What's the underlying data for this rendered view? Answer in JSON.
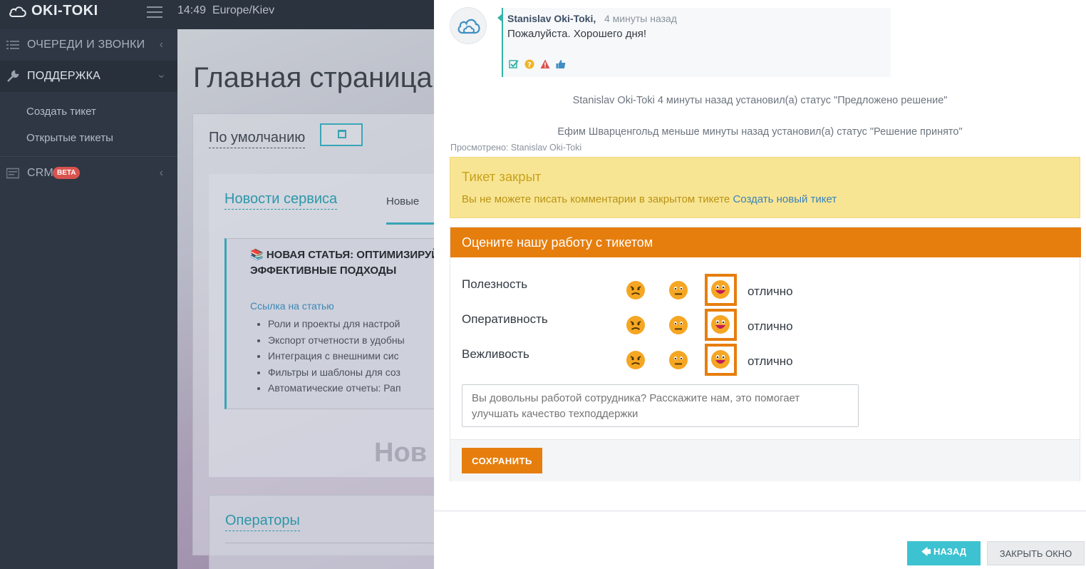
{
  "app": {
    "logo": "OKI-TOKI",
    "time": "14:49",
    "timezone": "Europe/Kiev"
  },
  "sidebar": {
    "items": [
      {
        "label": "ОЧЕРЕДИ И ЗВОНКИ",
        "icon": "list-icon"
      },
      {
        "label": "ПОДДЕРЖКА",
        "icon": "wrench-icon"
      },
      {
        "label": "CRM",
        "icon": "crm-icon",
        "badge": "BETA"
      }
    ],
    "sub_items": [
      "Создать тикет",
      "Открытые тикеты"
    ]
  },
  "main": {
    "title": "Главная страница",
    "filter_label": "По умолчанию",
    "news": {
      "title": "Новости сервиса",
      "tab": "Новые",
      "article_heading": "📚 НОВАЯ СТАТЬЯ: ОПТИМИЗИРУЙ ЭФФЕКТИВНЫЕ ПОДХОДЫ",
      "article_link": "Ссылка на статью",
      "article_points": [
        "Роли и проекты для настрой",
        "Экспорт отчетности в удобны",
        "Интеграция с внешними сис",
        "Фильтры и шаблоны для соз",
        "Автоматические отчеты: Рап"
      ],
      "faded_text": "Нов"
    },
    "operators_title": "Операторы"
  },
  "ticket": {
    "comment": {
      "author": "Stanislav Oki-Toki,",
      "time": "4 минуты назад",
      "text": "Пожалуйста. Хорошего дня!"
    },
    "status_events": [
      "Stanislav Oki-Toki 4 минуты назад установил(а) статус \"Предложено решение\"",
      "Ефим Шварценгольд меньше минуты назад установил(а) статус \"Решение принято\""
    ],
    "viewed": "Просмотрено: Stanislav Oki-Toki",
    "closed": {
      "title": "Тикет закрыт",
      "text": "Вы не можете писать комментарии в закрытом тикете",
      "link": "Создать новый тикет"
    },
    "rating": {
      "title": "Оцените нашу работу с тикетом",
      "rows": [
        {
          "label": "Полезность",
          "value": "отлично",
          "selected": "happy"
        },
        {
          "label": "Оперативность",
          "value": "отлично",
          "selected": "happy"
        },
        {
          "label": "Вежливость",
          "value": "отлично",
          "selected": "happy"
        }
      ],
      "feedback_placeholder": "Вы довольны работой сотрудника? Расскажите нам, это помогает улучшать качество техподдержки",
      "save_label": "СОХРАНИТЬ"
    },
    "footer": {
      "back_label": "НАЗАД",
      "close_label": "ЗАКРЫТЬ ОКНО"
    }
  },
  "colors": {
    "accent_orange": "#e67e0e",
    "accent_teal": "#3cc2d0",
    "warning_bg": "#f8e593",
    "sidebar_bg": "#2f3744"
  }
}
